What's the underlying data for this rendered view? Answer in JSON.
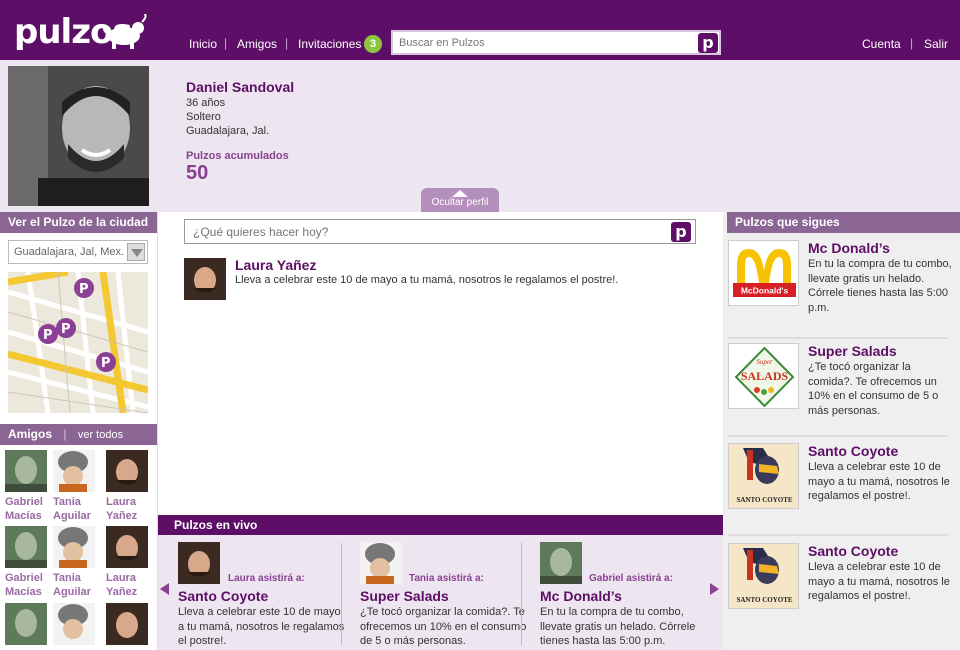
{
  "header": {
    "logo_text": "pulzos",
    "nav": {
      "inicio": "Inicio",
      "amigos": "Amigos",
      "invitaciones": "Invitaciones",
      "invitaciones_count": "3"
    },
    "search": {
      "placeholder": "Buscar en Pulzos"
    },
    "cuenta": "Cuenta",
    "salir": "Salir",
    "separator": "|"
  },
  "profile": {
    "name": "Daniel Sandoval",
    "age": "36 años",
    "status": "Soltero",
    "city": "Guadalajara, Jal.",
    "pulzos_label": "Pulzos acumulados",
    "pulzos_count": "50",
    "hide_label": "Ocultar perfil"
  },
  "left": {
    "city_heading": "Ver el Pulzo de la ciudad",
    "city_select": "Guadalajara, Jal, Mex.",
    "friends_heading": "Amigos",
    "see_all": "ver todos",
    "friends": [
      {
        "name1": "Gabriel",
        "name2": "Macías"
      },
      {
        "name1": "Tania",
        "name2": "Aguilar"
      },
      {
        "name1": "Laura",
        "name2": "Yañez"
      },
      {
        "name1": "Gabriel",
        "name2": "Macías"
      },
      {
        "name1": "Tania",
        "name2": "Aguilar"
      },
      {
        "name1": "Laura",
        "name2": "Yañez"
      }
    ]
  },
  "center": {
    "prompt_placeholder": "¿Qué quieres hacer hoy?",
    "post": {
      "author": "Laura Yañez",
      "text": "Lleva a celebrar este 10 de mayo a tu mamá, nosotros le regalamos el postre!."
    }
  },
  "live": {
    "heading": "Pulzos en vivo",
    "cards": [
      {
        "who": "Laura asistirá a:",
        "title": "Santo Coyote",
        "desc": "Lleva a celebrar este 10 de mayo a tu mamá, nosotros le regalamos el postre!."
      },
      {
        "who": "Tania asistirá a:",
        "title": "Super Salads",
        "desc": "¿Te tocó organizar la comida?. Te ofrecemos un 10% en el consumo de 5 o más personas."
      },
      {
        "who": "Gabriel asistirá a:",
        "title": "Mc Donald’s",
        "desc": "En tu la compra de tu combo, llevate gratis un helado. Córrele tienes hasta las 5:00 p.m."
      }
    ]
  },
  "right": {
    "heading": "Pulzos que sigues",
    "deals": [
      {
        "title": "Mc Donald’s",
        "desc": "En tu la compra de tu combo, llevate gratis un helado. Córrele tienes hasta las 5:00 p.m.",
        "logo_text": "McDonald's"
      },
      {
        "title": "Super Salads",
        "desc": "¿Te tocó organizar la comida?. Te ofrecemos un 10% en el consumo de 5 o más personas.",
        "logo_text": "SALADS",
        "logo_super": "Super"
      },
      {
        "title": "Santo Coyote",
        "desc": "Lleva a celebrar este 10 de mayo a tu mamá, nosotros le regalamos el postre!.",
        "logo_text": "SANTO COYOTE"
      },
      {
        "title": "Santo Coyote",
        "desc": "Lleva a celebrar este 10 de mayo a tu mamá, nosotros le regalamos el postre!.",
        "logo_text": "SANTO COYOTE"
      }
    ]
  },
  "colors": {
    "brand": "#5d0e66",
    "section": "#8b6593",
    "badge": "#8cc63f",
    "profile_bg": "#ede5ef"
  },
  "icons": [
    "pulzos-p-icon",
    "mascot-icon",
    "dropdown-arrow-icon",
    "map-pin-icon",
    "carousel-left-icon",
    "carousel-right-icon",
    "collapse-up-icon"
  ]
}
